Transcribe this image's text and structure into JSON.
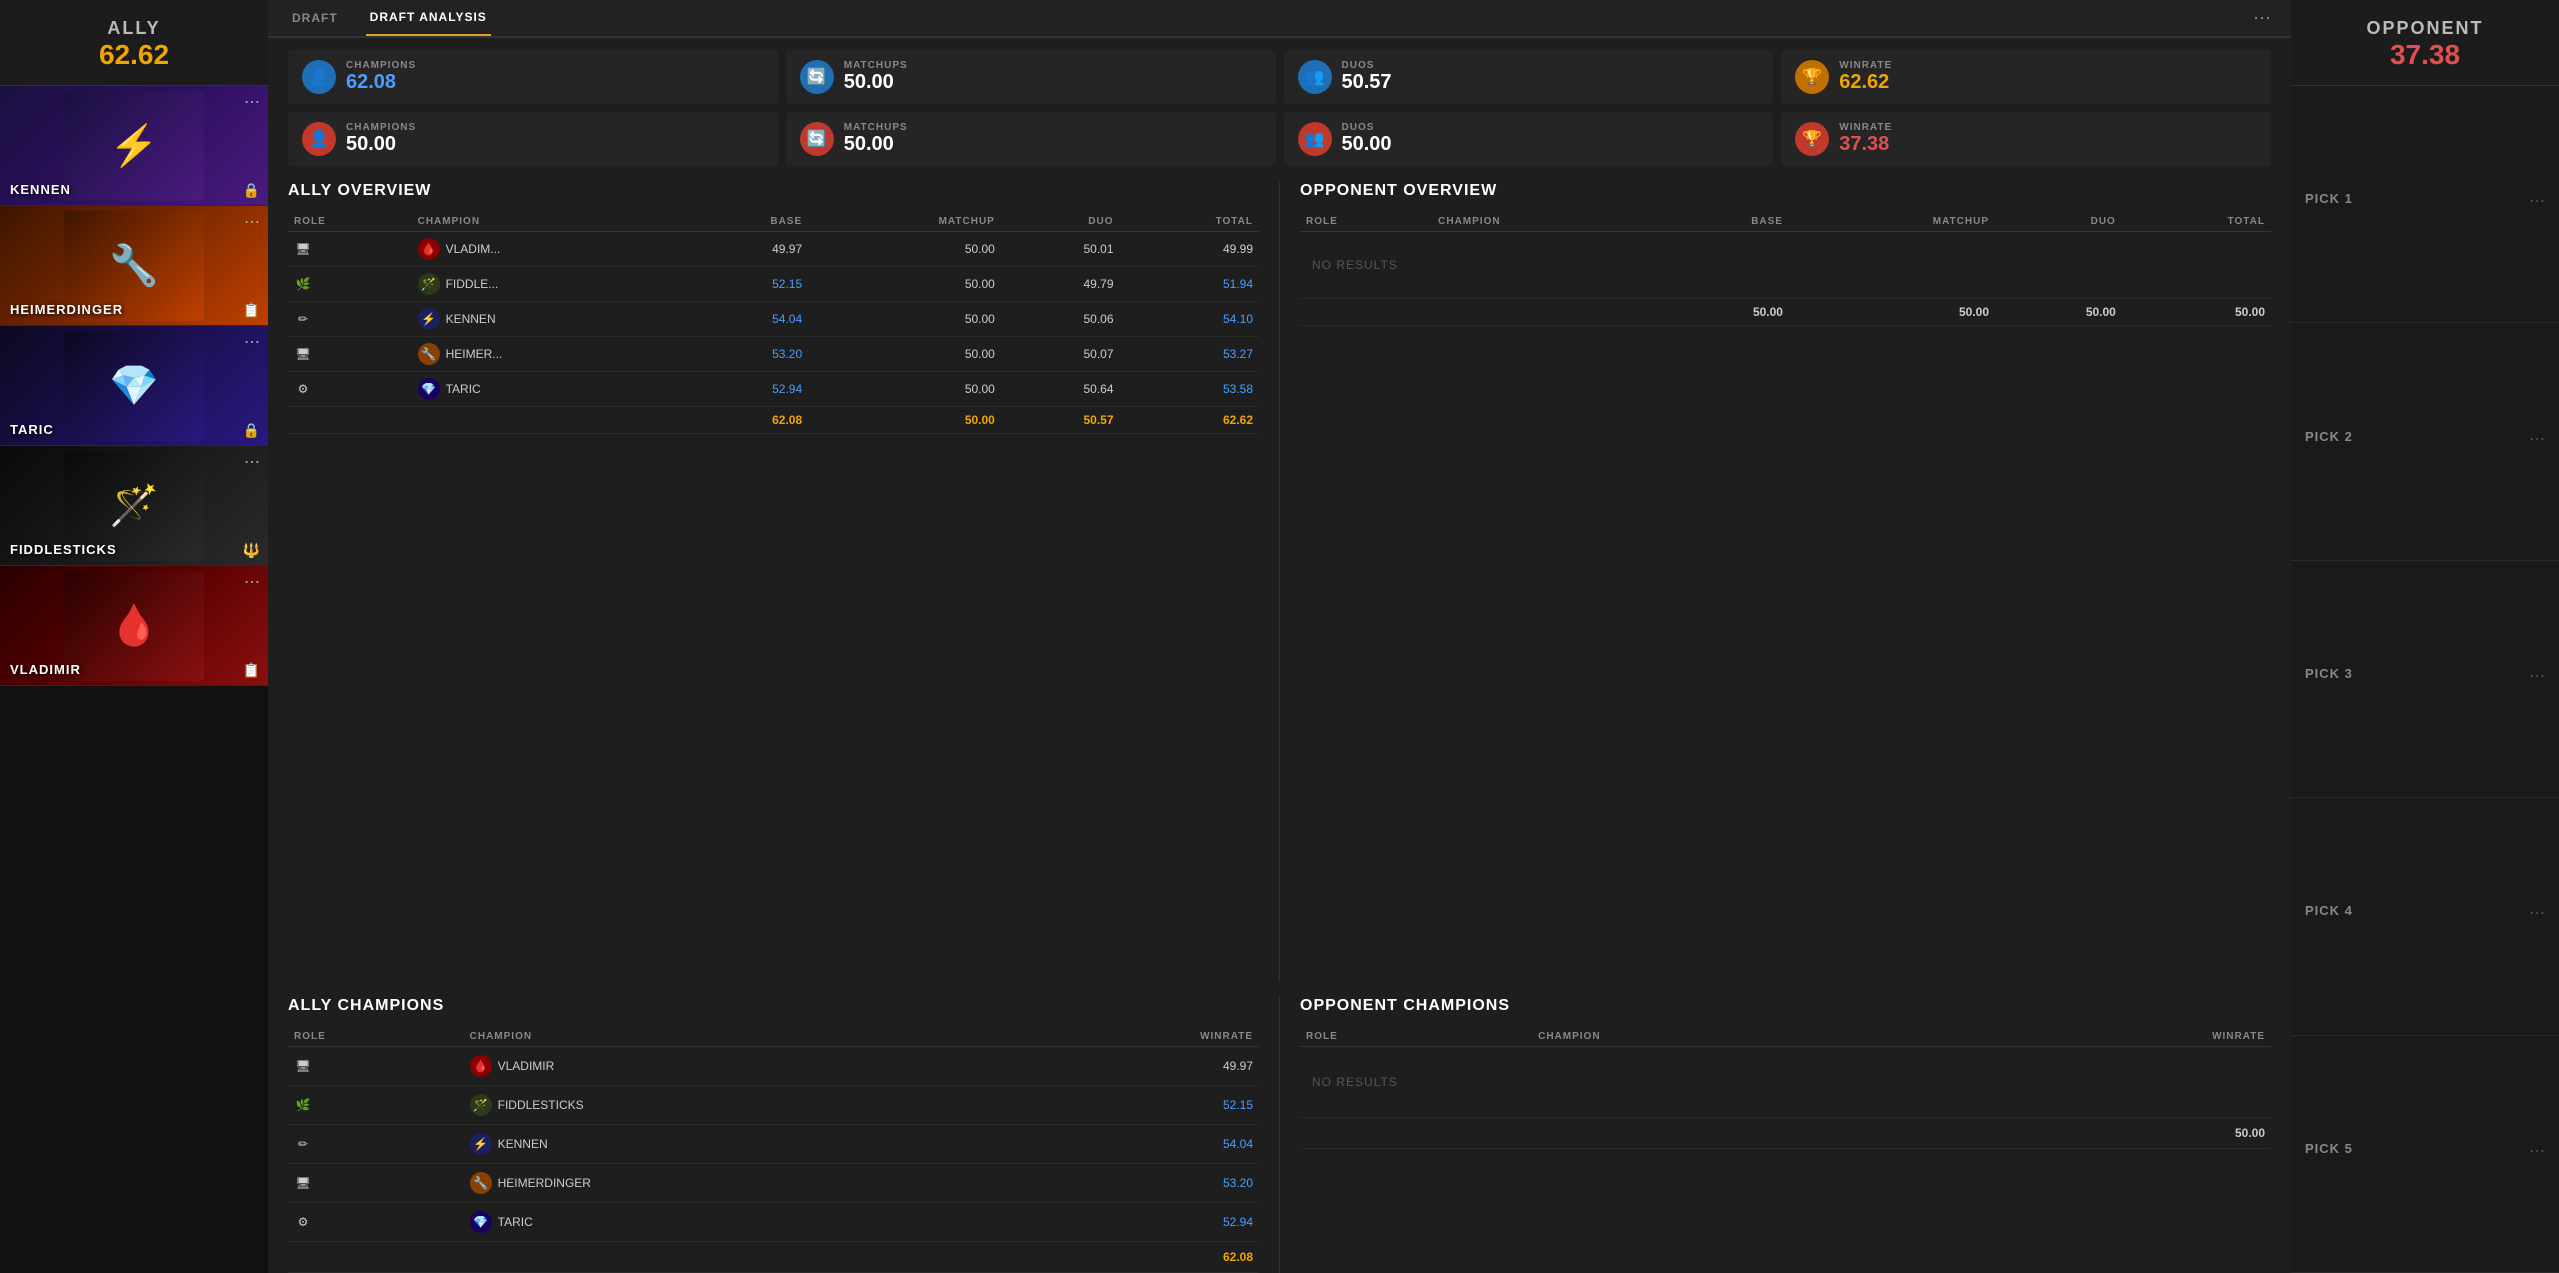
{
  "leftSidebar": {
    "allyLabel": "ALLY",
    "allyScore": "62.62",
    "champions": [
      {
        "name": "KENNEN",
        "color": "card-kennen",
        "icon": "⚡",
        "lockIcon": "🔒"
      },
      {
        "name": "HEIMERDINGER",
        "color": "card-heimer",
        "icon": "🔧",
        "lockIcon": "📋"
      },
      {
        "name": "TARIC",
        "color": "card-taric",
        "icon": "💎",
        "lockIcon": "🔒"
      },
      {
        "name": "FIDDLESTICKS",
        "color": "card-fiddlesticks",
        "icon": "🪄",
        "lockIcon": "🔱"
      },
      {
        "name": "VLADIMIR",
        "color": "card-vladimir",
        "icon": "🩸",
        "lockIcon": "📋"
      }
    ]
  },
  "topBar": {
    "tabs": [
      {
        "label": "DRAFT",
        "active": false
      },
      {
        "label": "DRAFT ANALYSIS",
        "active": true
      }
    ]
  },
  "allyStats": {
    "champions": {
      "label": "CHAMPIONS",
      "value": "62.08",
      "color": "blue"
    },
    "matchups": {
      "label": "MATCHUPS",
      "value": "50.00",
      "color": "white"
    },
    "duos": {
      "label": "DUOS",
      "value": "50.57",
      "color": "white"
    },
    "winrate": {
      "label": "WINRATE",
      "value": "62.62",
      "color": "orange"
    }
  },
  "opponentStats": {
    "champions": {
      "label": "CHAMPIONS",
      "value": "50.00",
      "color": "white"
    },
    "matchups": {
      "label": "MATCHUPS",
      "value": "50.00",
      "color": "white"
    },
    "duos": {
      "label": "DUOS",
      "value": "50.00",
      "color": "white"
    },
    "winrate": {
      "label": "WINRATE",
      "value": "37.38",
      "color": "red"
    }
  },
  "allyOverview": {
    "title": "ALLY OVERVIEW",
    "headers": [
      "ROLE",
      "CHAMPION",
      "BASE",
      "MATCHUP",
      "DUO",
      "TOTAL"
    ],
    "rows": [
      {
        "role": "🖥",
        "champion": "VLADIM...",
        "base": "49.97",
        "baseColor": "white",
        "matchup": "50.00",
        "duo": "50.01",
        "total": "49.99",
        "totalColor": "white"
      },
      {
        "role": "🌿",
        "champion": "FIDDLE...",
        "base": "52.15",
        "baseColor": "blue",
        "matchup": "50.00",
        "duo": "49.79",
        "total": "51.94",
        "totalColor": "blue"
      },
      {
        "role": "✏",
        "champion": "KENNEN",
        "base": "54.04",
        "baseColor": "blue",
        "matchup": "50.00",
        "duo": "50.06",
        "total": "54.10",
        "totalColor": "blue"
      },
      {
        "role": "🖥",
        "champion": "HEIMER...",
        "base": "53.20",
        "baseColor": "blue",
        "matchup": "50.00",
        "duo": "50.07",
        "total": "53.27",
        "totalColor": "blue"
      },
      {
        "role": "⚙",
        "champion": "TARIC",
        "base": "52.94",
        "baseColor": "blue",
        "matchup": "50.00",
        "duo": "50.64",
        "total": "53.58",
        "totalColor": "blue"
      }
    ],
    "totalRow": {
      "base": "62.08",
      "matchup": "50.00",
      "duo": "50.57",
      "total": "62.62"
    }
  },
  "opponentOverview": {
    "title": "OPPONENT OVERVIEW",
    "headers": [
      "ROLE",
      "CHAMPION",
      "BASE",
      "MATCHUP",
      "DUO",
      "TOTAL"
    ],
    "noResults": "NO RESULTS",
    "totalRow": {
      "base": "50.00",
      "matchup": "50.00",
      "duo": "50.00",
      "total": "50.00"
    }
  },
  "allyChampions": {
    "title": "ALLY CHAMPIONS",
    "headers": [
      "ROLE",
      "CHAMPION",
      "WINRATE"
    ],
    "rows": [
      {
        "role": "🖥",
        "champion": "VLADIMIR",
        "winrate": "49.97",
        "winrateColor": "white"
      },
      {
        "role": "🌿",
        "champion": "FIDDLESTICKS",
        "winrate": "52.15",
        "winrateColor": "blue"
      },
      {
        "role": "✏",
        "champion": "KENNEN",
        "winrate": "54.04",
        "winrateColor": "blue"
      },
      {
        "role": "🖥",
        "champion": "HEIMERDINGER",
        "winrate": "53.20",
        "winrateColor": "blue"
      },
      {
        "role": "⚙",
        "champion": "TARIC",
        "winrate": "52.94",
        "winrateColor": "blue"
      }
    ],
    "totalRow": {
      "winrate": "62.08",
      "winrateColor": "orange"
    }
  },
  "opponentChampions": {
    "title": "OPPONENT CHAMPIONS",
    "headers": [
      "ROLE",
      "CHAMPION",
      "WINRATE"
    ],
    "noResults": "NO RESULTS",
    "totalRow": {
      "winrate": "50.00"
    }
  },
  "rightSidebar": {
    "opponentLabel": "OPPONENT",
    "opponentScore": "37.38",
    "picks": [
      {
        "label": "PICK 1"
      },
      {
        "label": "PICK 2"
      },
      {
        "label": "PICK 3"
      },
      {
        "label": "PICK 4"
      },
      {
        "label": "PICK 5"
      }
    ]
  }
}
